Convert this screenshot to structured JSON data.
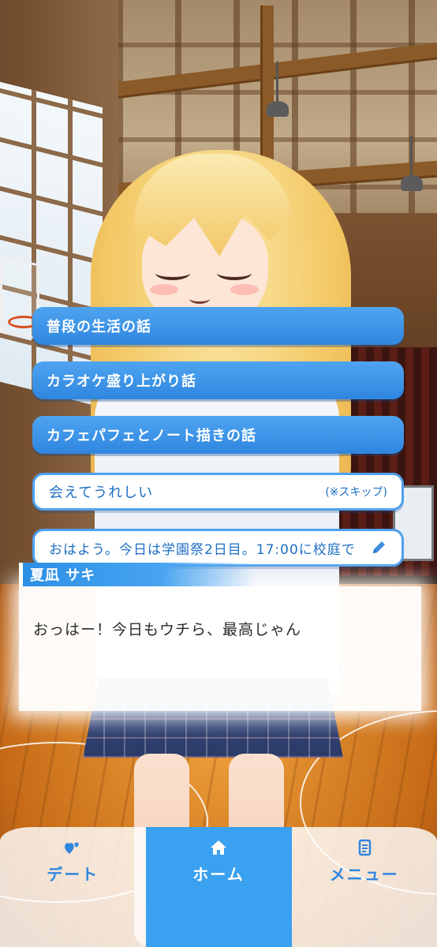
{
  "choices": [
    {
      "label": "普段の生活の話",
      "style": "blue"
    },
    {
      "label": "カラオケ盛り上がり話",
      "style": "blue"
    },
    {
      "label": "カフェパフェとノート描きの話",
      "style": "blue"
    },
    {
      "label": "会えてうれしい",
      "style": "white",
      "note": "(※スキップ)"
    },
    {
      "label": "おはよう。今日は学園祭2日目。17:00に校庭で",
      "style": "white",
      "icon": "pencil-icon"
    }
  ],
  "dialog": {
    "speaker": "夏凪 サキ",
    "text": "おっはー！今日もウチら、最高じゃん"
  },
  "nav": {
    "items": [
      {
        "label": "デート",
        "icon": "hearts-icon"
      },
      {
        "label": "ホーム",
        "icon": "home-icon",
        "active": true
      },
      {
        "label": "メニュー",
        "icon": "menu-list-icon"
      }
    ]
  },
  "colors": {
    "accent": "#3aa0f0",
    "choice_blue": "#2f86df",
    "text_blue": "#1d6fc4"
  }
}
